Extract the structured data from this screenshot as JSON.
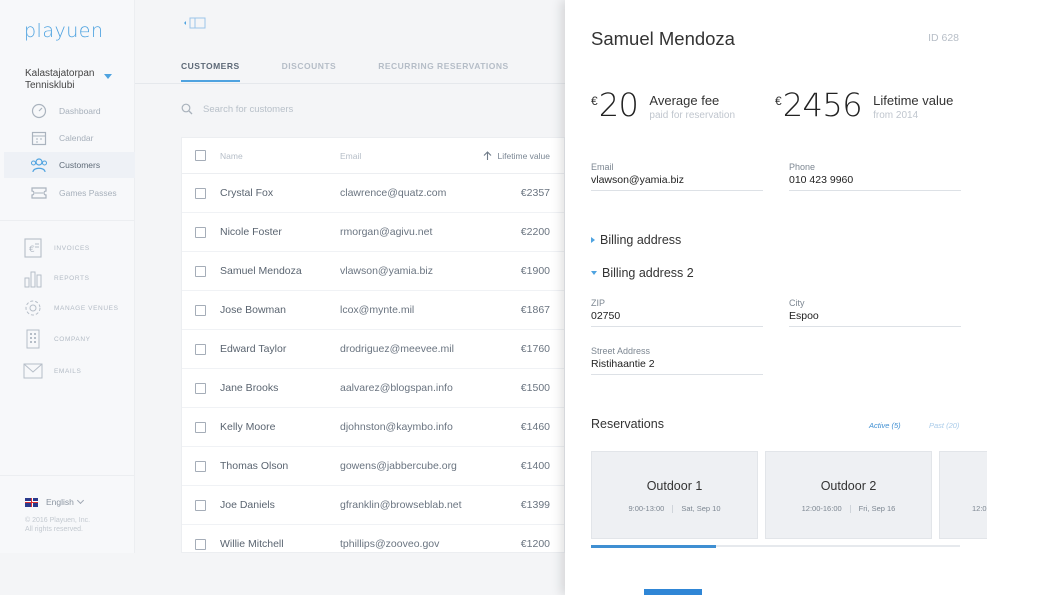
{
  "app": {
    "logo": "playuen",
    "club": "Kalastajatorpan Tennisklubi",
    "brand_color": "#4fa3e0"
  },
  "sidebar": {
    "primary": [
      {
        "label": "Dashboard",
        "icon": "dashboard-icon"
      },
      {
        "label": "Calendar",
        "icon": "calendar-icon"
      },
      {
        "label": "Customers",
        "icon": "customers-icon",
        "active": true
      },
      {
        "label": "Games Passes",
        "icon": "ticket-icon"
      }
    ],
    "secondary": [
      {
        "label": "INVOICES",
        "icon": "invoice-icon"
      },
      {
        "label": "REPORTS",
        "icon": "reports-icon"
      },
      {
        "label": "MANAGE VENUES",
        "icon": "gear-icon"
      },
      {
        "label": "COMPANY",
        "icon": "building-icon"
      },
      {
        "label": "EMAILS",
        "icon": "mail-icon"
      }
    ],
    "language": "English",
    "copyright_line1": "© 2016 Playuen, Inc.",
    "copyright_line2": "All rights reserved."
  },
  "main": {
    "tabs": [
      "CUSTOMERS",
      "DISCOUNTS",
      "RECURRING RESERVATIONS"
    ],
    "active_tab": 0,
    "search_placeholder": "Search for customers",
    "columns": {
      "name": "Name",
      "email": "Email",
      "value": "Lifetime value"
    },
    "rows": [
      {
        "name": "Crystal Fox",
        "email": "clawrence@quatz.com",
        "value": "€2357"
      },
      {
        "name": "Nicole Foster",
        "email": "rmorgan@agivu.net",
        "value": "€2200"
      },
      {
        "name": "Samuel Mendoza",
        "email": "vlawson@yamia.biz",
        "value": "€1900"
      },
      {
        "name": "Jose Bowman",
        "email": "lcox@mynte.mil",
        "value": "€1867"
      },
      {
        "name": "Edward Taylor",
        "email": "drodriguez@meevee.mil",
        "value": "€1760"
      },
      {
        "name": "Jane Brooks",
        "email": "aalvarez@blogspan.info",
        "value": "€1500"
      },
      {
        "name": "Kelly Moore",
        "email": "djohnston@kaymbo.info",
        "value": "€1460"
      },
      {
        "name": "Thomas Olson",
        "email": "gowens@jabbercube.org",
        "value": "€1400"
      },
      {
        "name": "Joe Daniels",
        "email": "gfranklin@browseblab.net",
        "value": "€1399"
      },
      {
        "name": "Willie Mitchell",
        "email": "tphillips@zooveo.gov",
        "value": "€1200"
      }
    ]
  },
  "detail": {
    "name": "Samuel Mendoza",
    "id": "ID 628",
    "avg_fee": {
      "currency": "€",
      "value": "20",
      "label": "Average fee",
      "sub": "paid for reservation"
    },
    "lifetime": {
      "currency": "€",
      "value": "2456",
      "label": "Lifetime value",
      "sub": "from 2014"
    },
    "email": {
      "label": "Email",
      "value": "vlawson@yamia.biz"
    },
    "phone": {
      "label": "Phone",
      "value": "010 423 9960"
    },
    "billing1": "Billing address",
    "billing2": "Billing address 2",
    "zip": {
      "label": "ZIP",
      "value": "02750"
    },
    "city": {
      "label": "City",
      "value": "Espoo"
    },
    "street": {
      "label": "Street Address",
      "value": "Ristihaantie 2"
    },
    "reservations": {
      "title": "Reservations",
      "active": "Active (5)",
      "past": "Past (20)",
      "cards": [
        {
          "title": "Outdoor 1",
          "time": "9:00-13:00",
          "date": "Sat, Sep 10"
        },
        {
          "title": "Outdoor 2",
          "time": "12:00-16:00",
          "date": "Fri, Sep 16"
        },
        {
          "title": "",
          "time": "12:0",
          "date": ""
        }
      ],
      "scroll_progress": 0.34
    }
  }
}
